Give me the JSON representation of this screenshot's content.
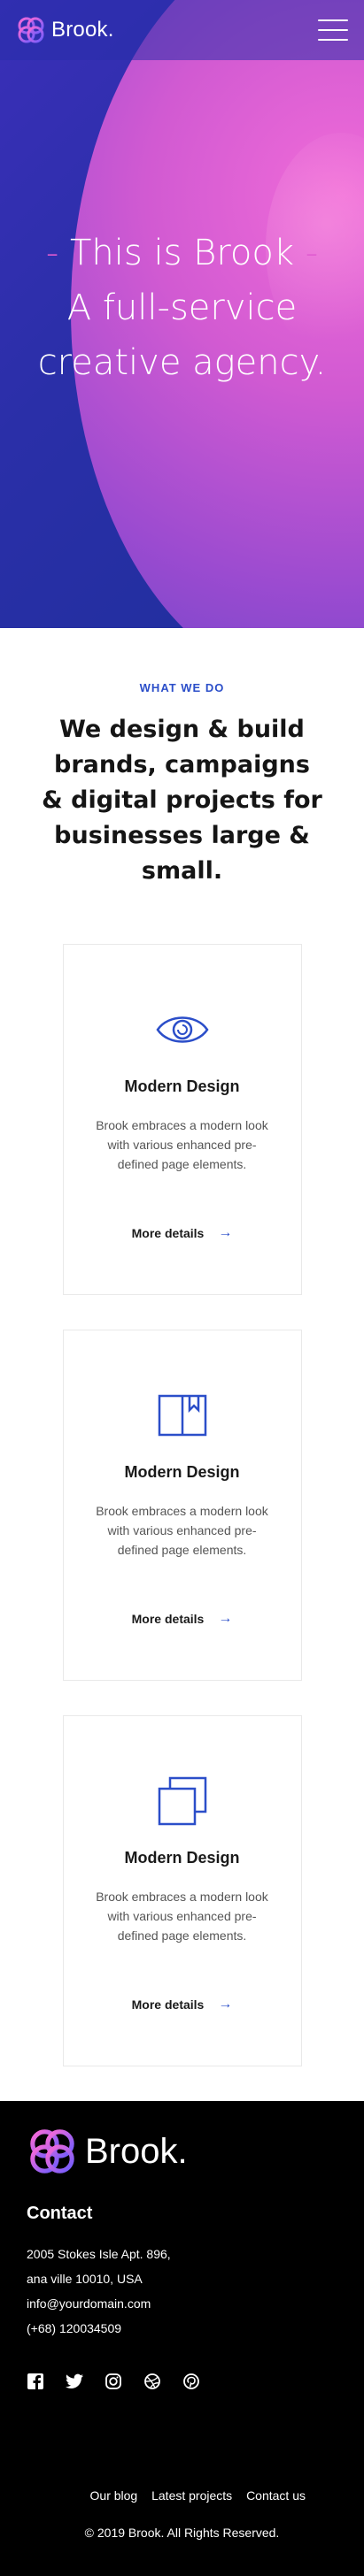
{
  "header": {
    "brand": "Brook.",
    "menu_icon": "hamburger-icon"
  },
  "hero": {
    "dash_left": "-",
    "line1": "This is Brook",
    "dash_right": "-",
    "line2": "A full-service",
    "line3": "creative agency."
  },
  "intro": {
    "eyebrow": "WHAT WE DO",
    "headline": "We design & build brands, campaigns & digital projects for businesses large & small."
  },
  "cards": [
    {
      "icon": "eye-icon",
      "title": "Modern Design",
      "text": "Brook embraces a modern look with various enhanced pre-defined page elements.",
      "link": "More details"
    },
    {
      "icon": "book-icon",
      "title": "Modern Design",
      "text": "Brook embraces a modern look with various enhanced pre-defined page elements.",
      "link": "More details"
    },
    {
      "icon": "layers-icon",
      "title": "Modern Design",
      "text": "Brook embraces a modern look with various enhanced pre-defined page elements.",
      "link": "More details"
    }
  ],
  "footer": {
    "brand": "Brook.",
    "contact_heading": "Contact",
    "address1": "2005 Stokes Isle Apt. 896,",
    "address2": "ana ville 10010, USA",
    "email": "info@yourdomain.com",
    "phone": "(+68) 120034509",
    "socials": [
      "facebook-icon",
      "twitter-icon",
      "instagram-icon",
      "dribbble-icon",
      "pinterest-icon"
    ],
    "links": [
      "Our blog",
      "Latest projects",
      "Contact us"
    ],
    "copyright": "© 2019 Brook. All Rights Reserved."
  },
  "colors": {
    "accent": "#2b4ec9",
    "hero_pink": "#e05bd0",
    "footer_bg": "#000000"
  }
}
